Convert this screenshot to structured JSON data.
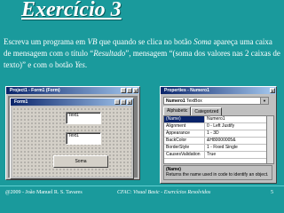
{
  "slide": {
    "title": "Exercício 3",
    "desc_1": "Escreva um programa em ",
    "desc_vb": "VB",
    "desc_2": " que quando se clica no botão ",
    "desc_soma": "Soma",
    "desc_3": " apareça uma caixa de mensagem com o título “",
    "desc_resultado": "Resultado",
    "desc_4": "”, mensagem “(soma dos valores nas 2 caixas de texto)” e com o botão ",
    "desc_yes": "Yes",
    "desc_5": "."
  },
  "project_window": {
    "title": "Project1 - Form1 (Form)",
    "form_title": "Form1",
    "textbox1": "Text1",
    "textbox2": "Text1",
    "button": "Soma"
  },
  "properties_window": {
    "title": "Properties - Numero1",
    "object_name": "Numero1",
    "object_type": "TextBox",
    "tab_alphabetic": "Alphabetic",
    "tab_categorized": "Categorized",
    "rows": [
      {
        "k": "(Name)",
        "v": "Numero1"
      },
      {
        "k": "Alignment",
        "v": "0 - Left Justify"
      },
      {
        "k": "Appearance",
        "v": "1 - 3D"
      },
      {
        "k": "BackColor",
        "v": "&H80000005&"
      },
      {
        "k": "BorderStyle",
        "v": "1 - Fixed Single"
      },
      {
        "k": "CausesValidation",
        "v": "True"
      }
    ],
    "help_name": "(Name)",
    "help_text": "Returns the name used in code to identify an object."
  },
  "footer": {
    "left": "@2009 - João Manuel R. S. Tavares",
    "center": "CFAC: Visual Basic - Exercícios Resolvidos",
    "page": "5"
  }
}
